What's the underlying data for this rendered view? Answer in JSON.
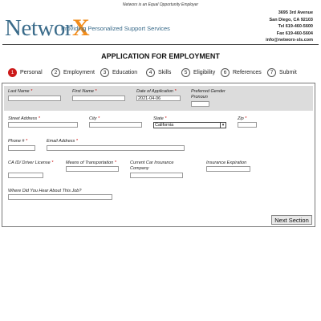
{
  "header": {
    "eoe_notice": "Networx is an Equal Opportunity Employer",
    "logo_text": "Networ",
    "logo_x": "X",
    "tagline": "Providing Personalized Support Services",
    "contact": {
      "address1": "3695 3rd Avenue",
      "address2": "San Diego, CA 92103",
      "tel": "Tel 619-460-5600",
      "fax": "Fax 619-460-5604",
      "email": "info@networx-sls.com"
    }
  },
  "page_title": "APPLICATION FOR EMPLOYMENT",
  "steps": [
    {
      "num": "1",
      "label": "Personal",
      "active": true
    },
    {
      "num": "2",
      "label": "Employment",
      "active": false
    },
    {
      "num": "3",
      "label": "Education",
      "active": false
    },
    {
      "num": "4",
      "label": "Skills",
      "active": false
    },
    {
      "num": "5",
      "label": "Eligibility",
      "active": false
    },
    {
      "num": "6",
      "label": "References",
      "active": false
    },
    {
      "num": "7",
      "label": "Submit",
      "active": false
    }
  ],
  "form": {
    "last_name": {
      "label": "Last Name",
      "req": "*",
      "value": ""
    },
    "first_name": {
      "label": "First Name",
      "req": "*",
      "value": ""
    },
    "date_of_application": {
      "label": "Date of Application",
      "req": "*",
      "value": "2021-04-06"
    },
    "preferred_gender_pronoun": {
      "label": "Preferred Gender Pronoun",
      "value": ""
    },
    "street_address": {
      "label": "Street Address",
      "req": "*",
      "value": ""
    },
    "city": {
      "label": "City",
      "req": "*",
      "value": ""
    },
    "state": {
      "label": "State",
      "req": "*",
      "value": "California"
    },
    "zip": {
      "label": "Zip",
      "req": "*",
      "value": ""
    },
    "phone": {
      "label": "Phone #",
      "req": "*",
      "value": ""
    },
    "email": {
      "label": "Email Address",
      "req": "*",
      "value": ""
    },
    "ca_id": {
      "label": "CA ID/ Driver License",
      "req": "*",
      "value": ""
    },
    "transportation": {
      "label": "Means of Transportation",
      "req": "*",
      "value": ""
    },
    "insurance_company": {
      "label": "Current Car Insurance Company",
      "value": ""
    },
    "insurance_expiration": {
      "label": "Insurance Expiration",
      "value": ""
    },
    "heard_about": {
      "label": "Where Did You Hear About This Job?",
      "value": ""
    }
  },
  "next_button": "Next Section",
  "colors": {
    "accent_red": "#cc1a1a",
    "logo_blue": "#3a6b8a",
    "logo_orange": "#f28c1a"
  }
}
